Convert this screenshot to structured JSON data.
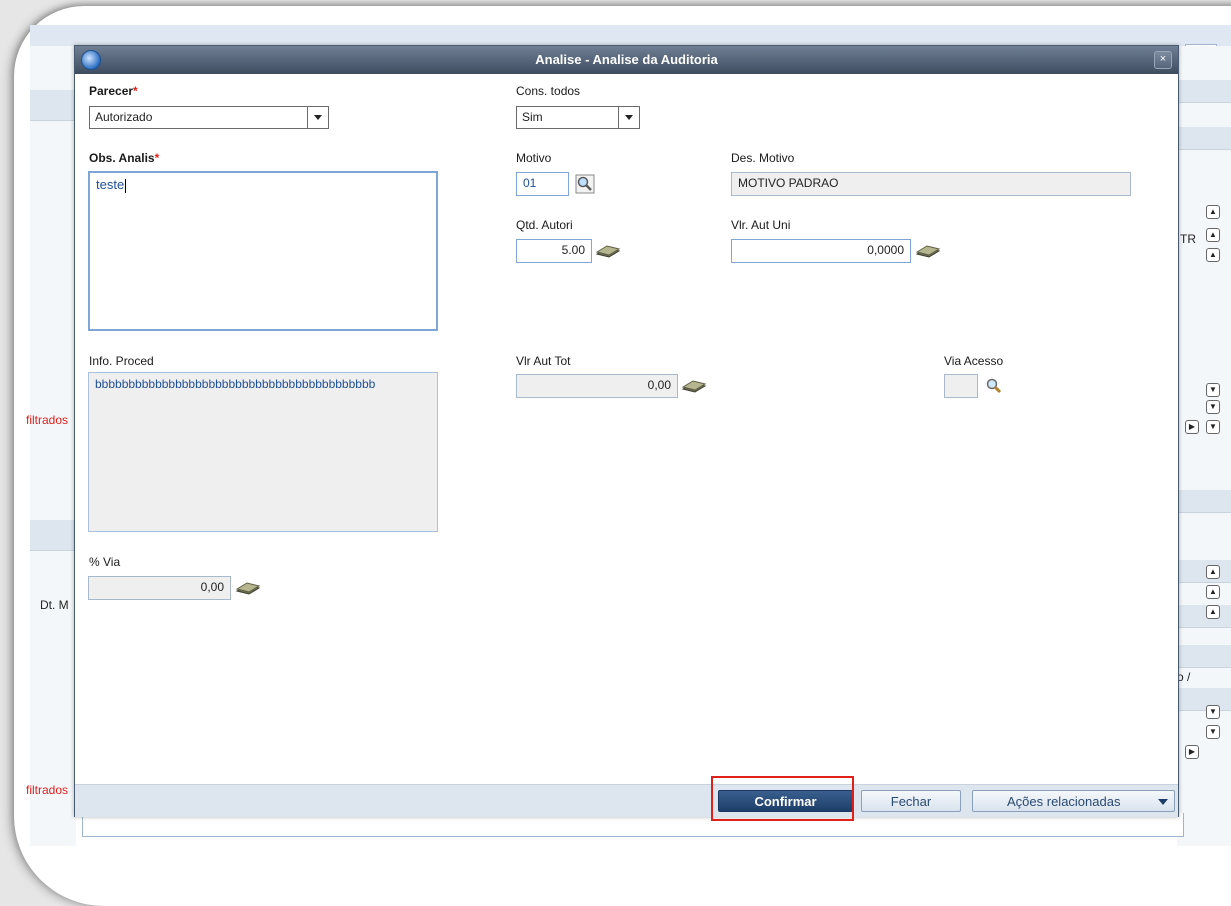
{
  "dialog": {
    "title": "Analise - Analise da Auditoria",
    "close_label": "×"
  },
  "fields": {
    "parecer": {
      "label": "Parecer",
      "required_mark": "*",
      "value": "Autorizado"
    },
    "cons_todos": {
      "label": "Cons. todos",
      "value": "Sim"
    },
    "obs_analis": {
      "label": "Obs. Analis",
      "required_mark": "*",
      "value": "teste"
    },
    "motivo": {
      "label": "Motivo",
      "value": "01"
    },
    "des_motivo": {
      "label": "Des. Motivo",
      "value": "MOTIVO PADRAO"
    },
    "qtd_autori": {
      "label": "Qtd. Autori",
      "value": "5.00"
    },
    "vlr_aut_uni": {
      "label": "Vlr. Aut Uni",
      "value": "0,0000"
    },
    "info_proced": {
      "label": "Info. Proced",
      "value": "bbbbbbbbbbbbbbbbbbbbbbbbbbbbbbbbbbbbbbbbbb"
    },
    "vlr_aut_tot": {
      "label": "Vlr Aut Tot",
      "value": "0,00"
    },
    "via_acesso": {
      "label": "Via Acesso",
      "value": ""
    },
    "pct_via": {
      "label": "% Via",
      "value": "0,00"
    }
  },
  "footer": {
    "confirm_label": "Confirmar",
    "close_label": "Fechar",
    "actions_label": "Ações relacionadas"
  },
  "background": {
    "filtrados_1": "filtrados",
    "filtrados_2": "filtrados",
    "dt_m": "Dt. M",
    "tr_text": "TR",
    "o_text": "o /"
  },
  "colors": {
    "accent": "#1d3e69",
    "required": "#e0201b",
    "highlight": "#e0201b"
  }
}
